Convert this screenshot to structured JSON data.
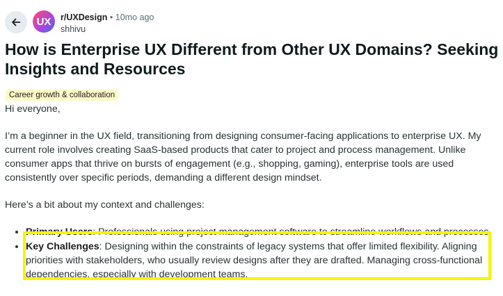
{
  "header": {
    "back_icon": "arrow-left-icon",
    "subreddit_avatar_text": "UX",
    "subreddit": "r/UXDesign",
    "separator": "•",
    "time_ago": "10mo ago",
    "author": "shhivu"
  },
  "post": {
    "title": "How is Enterprise UX Different from Other UX Domains? Seeking Insights and Resources",
    "flair": "Career growth & collaboration",
    "greeting": "Hi everyone,",
    "intro": "I’m a beginner in the UX field, transitioning from designing consumer-facing applications to enterprise UX. My current role involves creating SaaS-based products that cater to project and process management. Unlike consumer apps that thrive on bursts of engagement (e.g., shopping, gaming), enterprise tools are used consistently over specific periods, demanding a different design mindset.",
    "context_heading": "Here’s a bit about my context and challenges:",
    "bullets": [
      {
        "label": "Primary Users",
        "text": ": Professionals using project management software to streamline workflows and processes."
      },
      {
        "label": "Key Challenges",
        "text": ": Designing within the constraints of legacy systems that offer limited flexibility. Aligning priorities with stakeholders, who usually review designs after they are drafted. Managing cross-functional dependencies, especially with development teams."
      }
    ]
  },
  "colors": {
    "highlight": "#f5f500",
    "flair_bg": "#fff9c7"
  }
}
